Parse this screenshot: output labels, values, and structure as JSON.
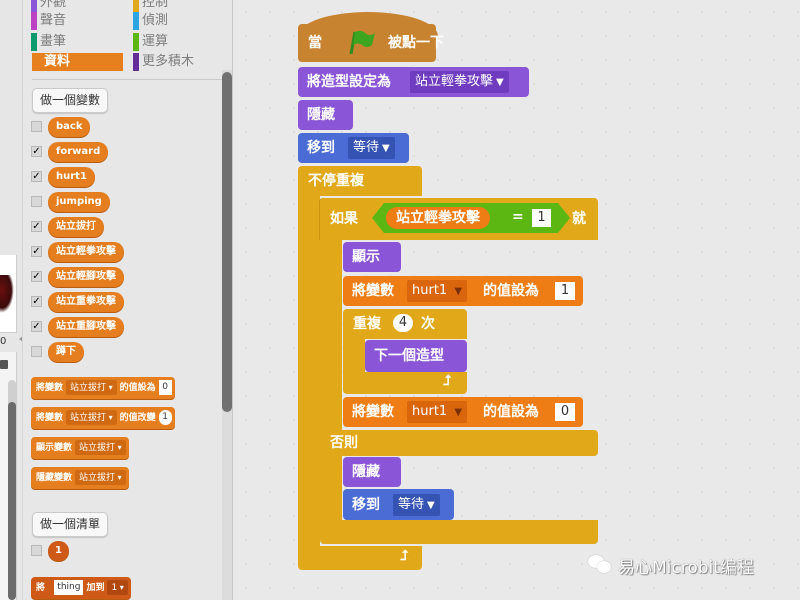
{
  "categories": [
    {
      "label": "外觀",
      "color": "#8a55d7",
      "selected": false
    },
    {
      "label": "控制",
      "color": "#e1a91a",
      "selected": false
    },
    {
      "label": "聲音",
      "color": "#bb42c3",
      "selected": false
    },
    {
      "label": "偵測",
      "color": "#2ca5e2",
      "selected": false
    },
    {
      "label": "畫筆",
      "color": "#0e9a6c",
      "selected": false
    },
    {
      "label": "運算",
      "color": "#5cb712",
      "selected": false
    },
    {
      "label": "資料",
      "color": "#e6801f",
      "selected": true
    },
    {
      "label": "更多積木",
      "color": "#632d99",
      "selected": false
    }
  ],
  "stage": {
    "coord_text": "0"
  },
  "palette": {
    "make_variable_label": "做一個變數",
    "variables": [
      {
        "name": "back",
        "checked": false
      },
      {
        "name": "forward",
        "checked": true
      },
      {
        "name": "hurt1",
        "checked": true
      },
      {
        "name": "jumping",
        "checked": false
      },
      {
        "name": "站立拔打",
        "checked": true
      },
      {
        "name": "站立輕拳攻擊",
        "checked": true
      },
      {
        "name": "站立輕腳攻擊",
        "checked": true
      },
      {
        "name": "站立重拳攻擊",
        "checked": true
      },
      {
        "name": "站立重腳攻擊",
        "checked": true
      },
      {
        "name": "蹲下",
        "checked": false
      }
    ],
    "set_block": {
      "prefix": "將變數",
      "var": "站立拔打",
      "suffix": "的值設為",
      "value": "0"
    },
    "change_block": {
      "prefix": "將變數",
      "var": "站立拔打",
      "suffix": "的值改變",
      "value": "1"
    },
    "show_block": {
      "prefix": "顯示變數",
      "var": "站立拔打"
    },
    "hide_block": {
      "prefix": "隱藏變數",
      "var": "站立拔打"
    },
    "make_list_label": "做一個清單",
    "list_reporter": {
      "name": "1",
      "checked": false
    },
    "add_block": {
      "prefix": "將",
      "item": "thing",
      "middle": "加到",
      "list": "1"
    }
  },
  "script": {
    "hat": {
      "when": "當",
      "clicked": "被點一下"
    },
    "switch_costume": {
      "label": "將造型設定為",
      "costume": "站立輕拳攻擊"
    },
    "hide1": {
      "label": "隱藏"
    },
    "goto1": {
      "label": "移到",
      "target": "等待"
    },
    "forever": {
      "label": "不停重複"
    },
    "if_else": {
      "if": "如果",
      "var": "站立輕拳攻擊",
      "op": "=",
      "value": "1",
      "then": "就",
      "else": "否則"
    },
    "show": {
      "label": "顯示"
    },
    "set_hurt_1": {
      "prefix": "將變數",
      "var": "hurt1",
      "suffix": "的值設為",
      "value": "1"
    },
    "repeat": {
      "prefix": "重複",
      "count": "4",
      "suffix": "次"
    },
    "next_costume": {
      "label": "下一個造型"
    },
    "set_hurt_0": {
      "prefix": "將變數",
      "var": "hurt1",
      "suffix": "的值設為",
      "value": "0"
    },
    "hide2": {
      "label": "隱藏"
    },
    "goto2": {
      "label": "移到",
      "target": "等待"
    }
  },
  "watermark": {
    "text": "易心Microbit编程"
  }
}
